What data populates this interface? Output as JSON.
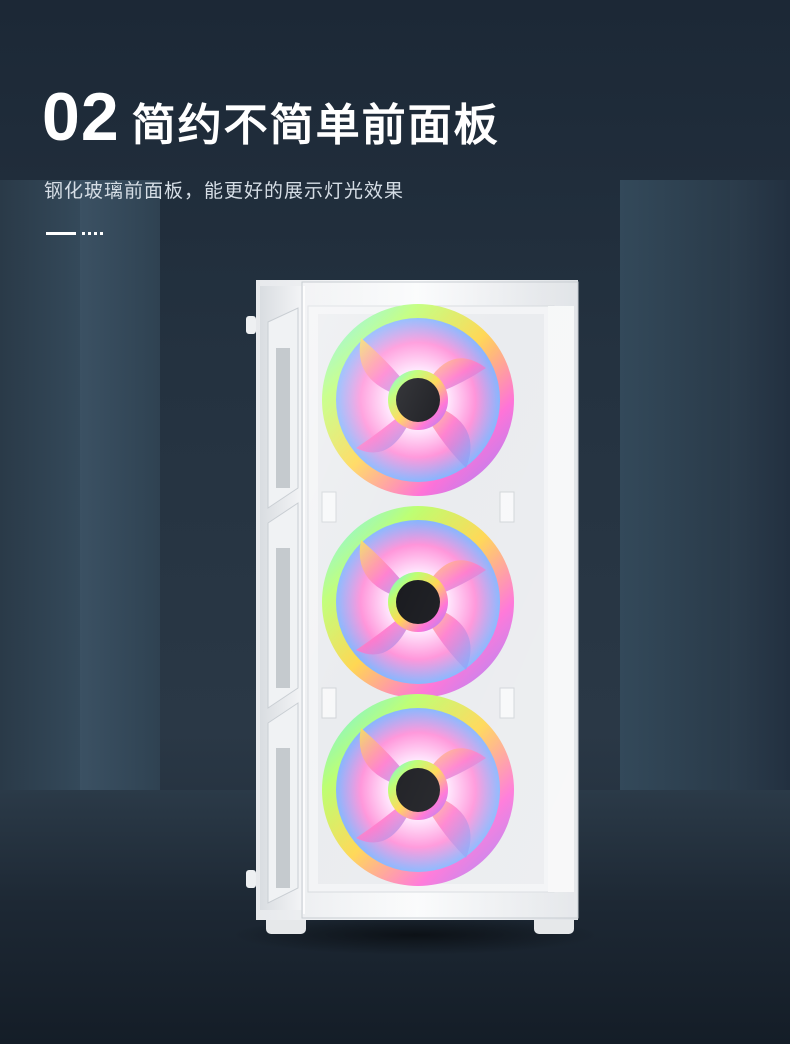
{
  "header": {
    "number": "02",
    "title": "简约不简单前面板",
    "subtitle": "钢化玻璃前面板，能更好的展示灯光效果"
  },
  "product": {
    "name-icon": "pc-case-icon",
    "fans": 3,
    "case_color": "#f4f5f6",
    "background_color": "#243240"
  }
}
